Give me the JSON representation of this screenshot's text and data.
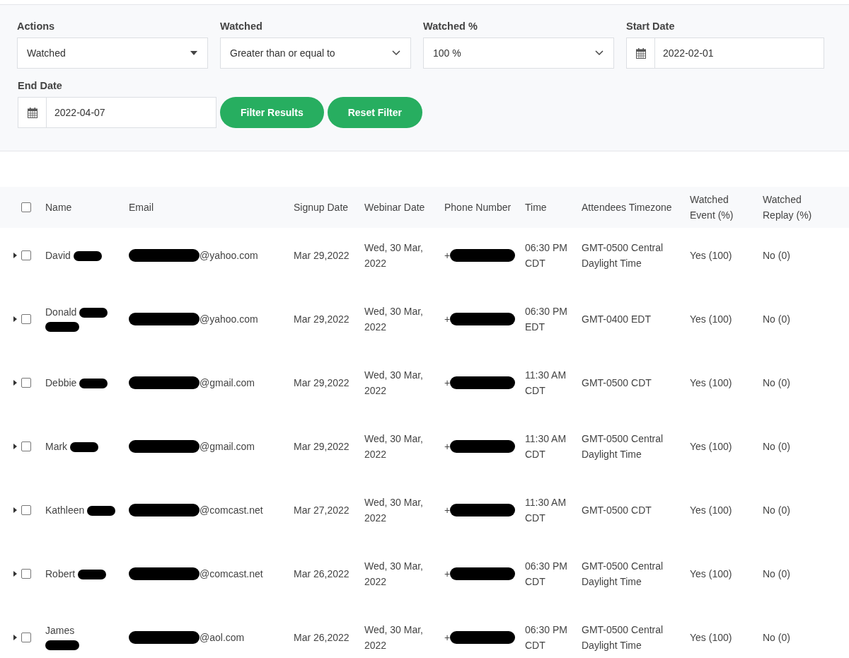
{
  "filters": {
    "actions": {
      "label": "Actions",
      "value": "Watched"
    },
    "watched": {
      "label": "Watched",
      "value": "Greater than or equal to"
    },
    "watched_pct": {
      "label": "Watched %",
      "value": "100 %"
    },
    "start_date": {
      "label": "Start Date",
      "value": "2022-02-01"
    },
    "end_date": {
      "label": "End Date",
      "value": "2022-04-07"
    },
    "buttons": [
      "Filter Results",
      "Reset Filter"
    ]
  },
  "table": {
    "select_all": {
      "checked": false
    },
    "columns": [
      "Name",
      "Email",
      "Signup Date",
      "Webinar Date",
      "Phone Number",
      "Time",
      "Attendees Timezone",
      "Watched Event (%)",
      "Watched Replay (%)"
    ],
    "rows": [
      {
        "checked": false,
        "name": "David",
        "redacted_inline": true,
        "redacted_below": false,
        "email": "@yahoo.com",
        "signup": "Mar 29,2022",
        "webinar": "Wed, 30 Mar, 2022",
        "phone": "+",
        "time": "06:30 PM CDT",
        "timezone": "GMT-0500 Central Daylight Time",
        "watched_event": "Yes (100)",
        "watched_replay": "No (0)"
      },
      {
        "checked": false,
        "name": "Donald",
        "redacted_inline": true,
        "redacted_below": true,
        "email": "@yahoo.com",
        "signup": "Mar 29,2022",
        "webinar": "Wed, 30 Mar, 2022",
        "phone": "+",
        "time": "06:30 PM EDT",
        "timezone": "GMT-0400 EDT",
        "watched_event": "Yes (100)",
        "watched_replay": "No (0)"
      },
      {
        "checked": false,
        "name": "Debbie",
        "redacted_inline": true,
        "redacted_below": false,
        "email": "@gmail.com",
        "signup": "Mar 29,2022",
        "webinar": "Wed, 30 Mar, 2022",
        "phone": "+",
        "time": "11:30 AM CDT",
        "timezone": "GMT-0500 CDT",
        "watched_event": "Yes (100)",
        "watched_replay": "No (0)"
      },
      {
        "checked": false,
        "name": "Mark",
        "redacted_inline": true,
        "redacted_below": false,
        "email": "@gmail.com",
        "signup": "Mar 29,2022",
        "webinar": "Wed, 30 Mar, 2022",
        "phone": "+",
        "time": "11:30 AM CDT",
        "timezone": "GMT-0500 Central Daylight Time",
        "watched_event": "Yes (100)",
        "watched_replay": "No (0)"
      },
      {
        "checked": false,
        "name": "Kathleen",
        "redacted_inline": true,
        "redacted_below": false,
        "email": "@comcast.net",
        "signup": "Mar 27,2022",
        "webinar": "Wed, 30 Mar, 2022",
        "phone": "+",
        "time": "11:30 AM CDT",
        "timezone": "GMT-0500 CDT",
        "watched_event": "Yes (100)",
        "watched_replay": "No (0)"
      },
      {
        "checked": false,
        "name": "Robert",
        "redacted_inline": true,
        "redacted_below": false,
        "email": "@comcast.net",
        "signup": "Mar 26,2022",
        "webinar": "Wed, 30 Mar, 2022",
        "phone": "+",
        "time": "06:30 PM CDT",
        "timezone": "GMT-0500 Central Daylight Time",
        "watched_event": "Yes (100)",
        "watched_replay": "No (0)"
      },
      {
        "checked": false,
        "name": "James",
        "redacted_inline": false,
        "redacted_below": true,
        "email": "@aol.com",
        "signup": "Mar 26,2022",
        "webinar": "Wed, 30 Mar, 2022",
        "phone": "+",
        "time": "06:30 PM CDT",
        "timezone": "GMT-0500 Central Daylight Time",
        "watched_event": "Yes (100)",
        "watched_replay": "No (0)"
      }
    ]
  }
}
